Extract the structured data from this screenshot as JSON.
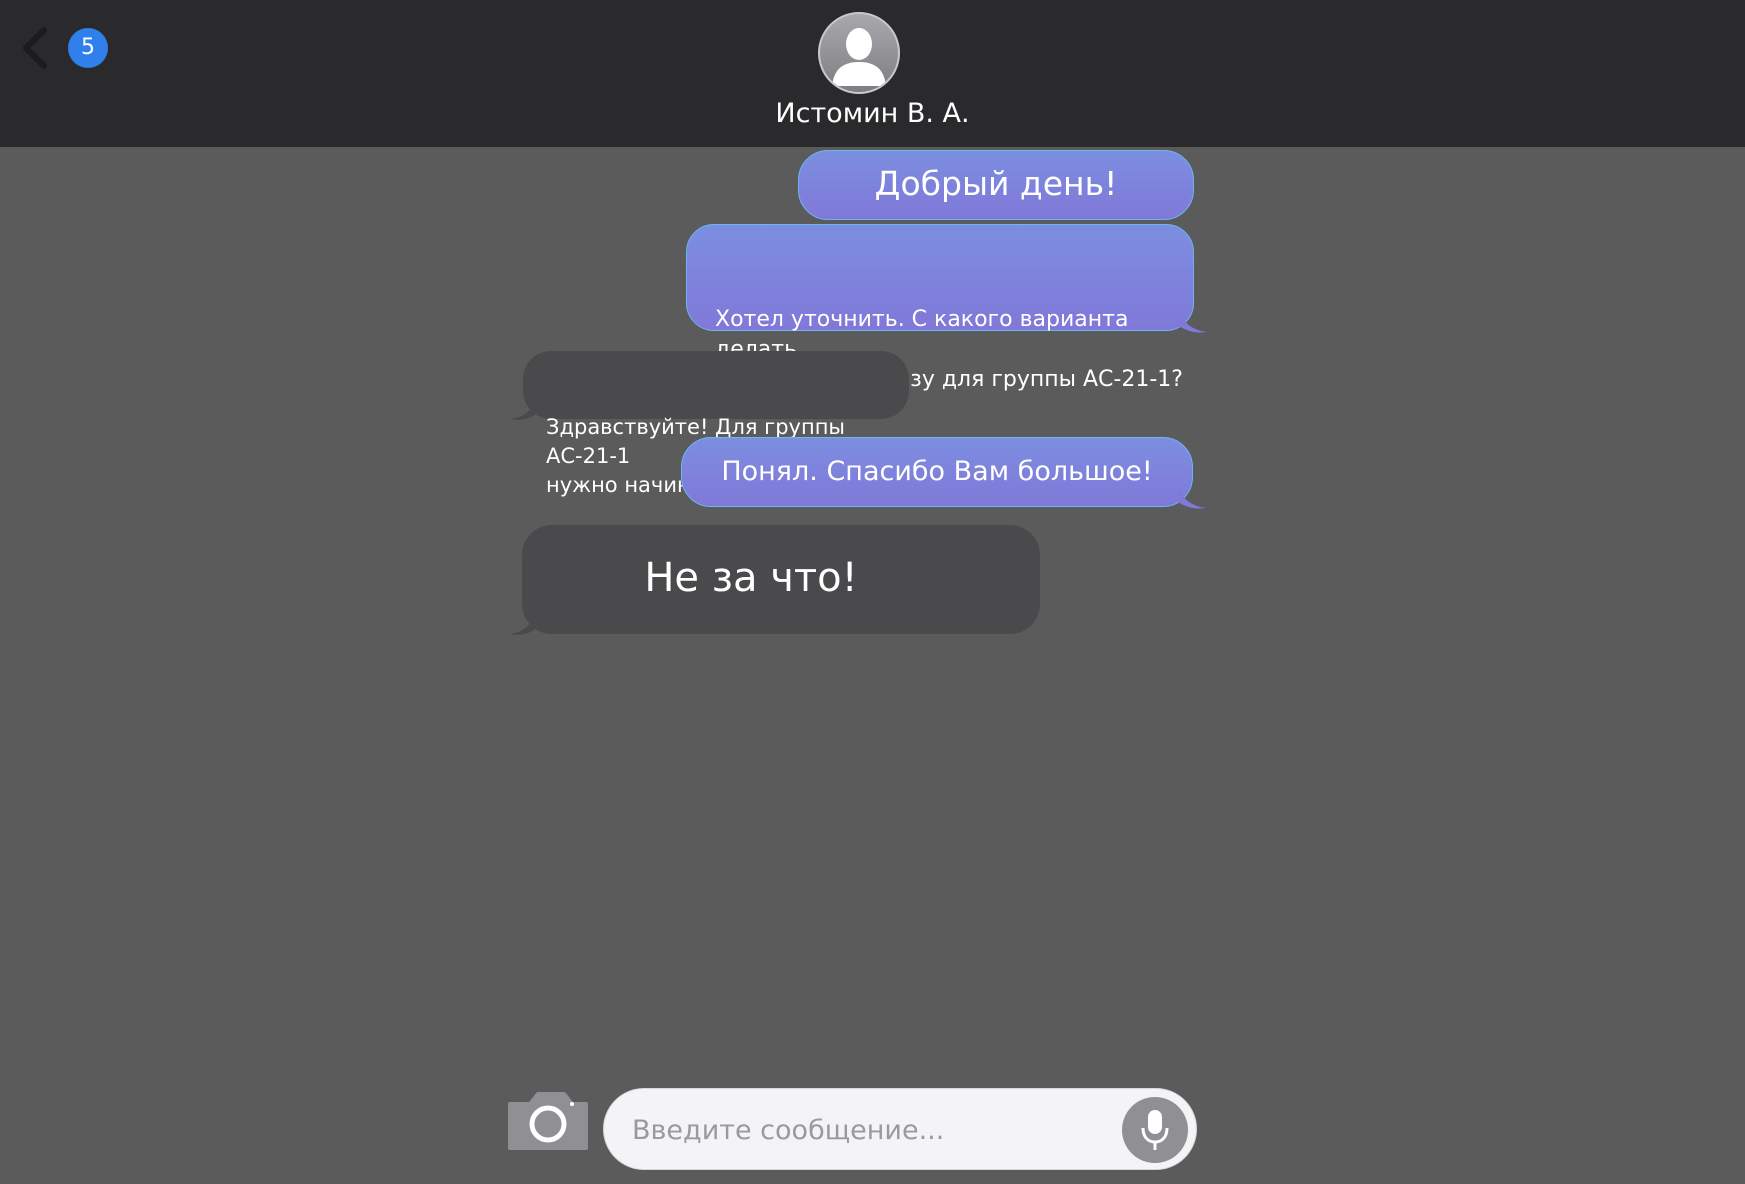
{
  "header": {
    "unread_count": "5",
    "contact_name": "Истомин В. А."
  },
  "messages": [
    {
      "direction": "outgoing",
      "text": "Добрый день!"
    },
    {
      "direction": "outgoing",
      "text": "Хотел уточнить. С какого варианта делать\nТР по мат. анализу для группы АС-21-1?"
    },
    {
      "direction": "incoming",
      "text": "Здравствуйте! Для группы АС-21-1\nнужно начинать с Варианта 31."
    },
    {
      "direction": "outgoing",
      "text": "Понял. Спасибо Вам большое!"
    },
    {
      "direction": "incoming",
      "text": "Не за что!"
    }
  ],
  "composer": {
    "placeholder": "Введите сообщение...",
    "value": ""
  },
  "icons": {
    "back": "chevron-left-icon",
    "avatar": "person-silhouette-icon",
    "camera": "camera-icon",
    "mic": "microphone-icon"
  },
  "colors": {
    "header_bg": "#2a2a2c",
    "background": "#5b5b5b",
    "outgoing_bubble": "#7d84dc",
    "incoming_bubble": "#4a4a4c",
    "badge": "#2f80ed"
  }
}
